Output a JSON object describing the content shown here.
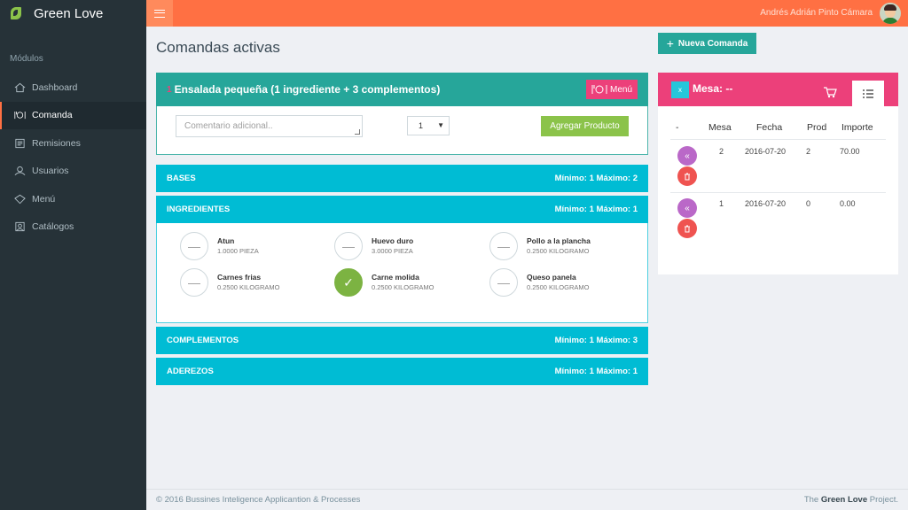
{
  "brand": "Green Love",
  "sidebar": {
    "section_label": "Módulos",
    "items": [
      {
        "label": "Dashboard",
        "icon": "home-icon"
      },
      {
        "label": "Comanda",
        "icon": "dinner-icon"
      },
      {
        "label": "Remisiones",
        "icon": "document-icon"
      },
      {
        "label": "Usuarios",
        "icon": "user-icon"
      },
      {
        "label": "Menú",
        "icon": "tag-icon"
      },
      {
        "label": "Catálogos",
        "icon": "catalog-icon"
      }
    ],
    "active": "Comanda"
  },
  "topbar": {
    "user_name": "Andrés Adrián Pinto Cámara"
  },
  "page": {
    "title": "Comandas activas",
    "new_button": "Nueva Comanda"
  },
  "product": {
    "number": "1",
    "title": "Ensalada pequeña (1 ingrediente + 3 complementos)",
    "menu_button": "Menú",
    "comment_placeholder": "Comentario adicional..",
    "quantity": "1",
    "add_button": "Agregar Producto"
  },
  "sections": [
    {
      "name": "BASES",
      "limits": "Mínimo: 1 Máximo: 2"
    },
    {
      "name": "INGREDIENTES",
      "limits": "Mínimo: 1 Máximo: 1"
    },
    {
      "name": "COMPLEMENTOS",
      "limits": "Mínimo: 1 Máximo: 3"
    },
    {
      "name": "ADEREZOS",
      "limits": "Mínimo: 1 Máximo: 1"
    }
  ],
  "ingredients": [
    {
      "name": "Atun",
      "qty": "1.0000 PIEZA",
      "selected": false
    },
    {
      "name": "Huevo duro",
      "qty": "3.0000 PIEZA",
      "selected": false
    },
    {
      "name": "Pollo a la plancha",
      "qty": "0.2500 KILOGRAMO",
      "selected": false
    },
    {
      "name": "Carnes frias",
      "qty": "0.2500 KILOGRAMO",
      "selected": false
    },
    {
      "name": "Carne molida",
      "qty": "0.2500 KILOGRAMO",
      "selected": true
    },
    {
      "name": "Queso panela",
      "qty": "0.2500 KILOGRAMO",
      "selected": false
    }
  ],
  "order_panel": {
    "close_label": "x",
    "mesa_label": "Mesa:",
    "mesa_value": "--",
    "columns": [
      "-",
      "Mesa",
      "Fecha",
      "Prod",
      "Importe"
    ],
    "rows": [
      {
        "mesa": "2",
        "fecha": "2016-07-20",
        "prod": "2",
        "importe": "70.00"
      },
      {
        "mesa": "1",
        "fecha": "2016-07-20",
        "prod": "0",
        "importe": "0.00"
      }
    ]
  },
  "footer": {
    "left": "© 2016 Bussines Inteligence Applicantion & Processes",
    "right_prefix": "The",
    "right_brand": "Green Love",
    "right_suffix": "Project."
  },
  "colors": {
    "sidebar": "#263238",
    "topbar": "#ff7043",
    "teal": "#26a69a",
    "cyan": "#00bcd4",
    "pink": "#ec407a",
    "green": "#8bc34a"
  }
}
